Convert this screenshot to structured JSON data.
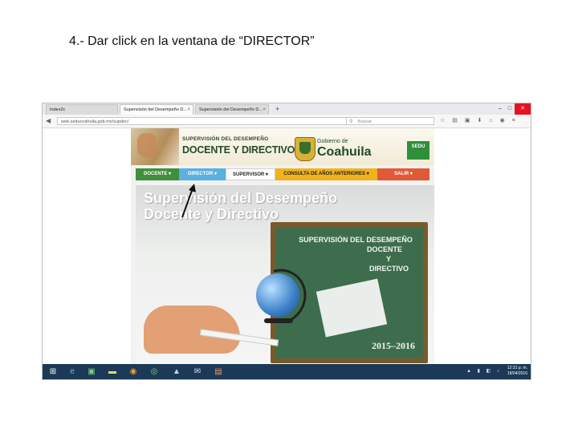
{
  "caption": "4.- Dar click en la ventana de “DIRECTOR”",
  "browser": {
    "tabs": [
      {
        "label": "Index2c",
        "active": false
      },
      {
        "label": "Supervisión del Desempeño D...",
        "active": true
      },
      {
        "label": "Supervisión del Desempeño D...",
        "active": false
      }
    ],
    "new_tab": "+",
    "url": "web.seducoahuila.gob.mx/supdoc/",
    "search_placeholder": "Buscar"
  },
  "site": {
    "header_small": "SUPERVISIÓN DEL DESEMPEÑO",
    "header_big": "DOCENTE Y DIRECTIVO",
    "gov_small": "Gobierno de",
    "gov_big": "Coahuila",
    "sedu": "SEDU",
    "menu": {
      "docente": "DOCENTE ▾",
      "director": "DIRECTOR ▾",
      "supervisor": "SUPERVISOR ▾",
      "consulta": "CONSULTA DE AÑOS ANTERIORES ▾",
      "salir": "SALIR ▾"
    },
    "banner_title_1": "Supervisión del Desempeño",
    "banner_title_2": "Docente y Directivo",
    "board_line1": "SUPERVISIÓN DEL DESEMPEÑO",
    "board_line2": "DOCENTE",
    "board_line3": "Y",
    "board_line4": "DIRECTIVO",
    "board_year": "2015–2016"
  },
  "colors": {
    "director_tab": "#5ab0e0",
    "docente_tab": "#3f8f3c",
    "consulta_tab": "#f2b21a",
    "salir_tab": "#e05a36"
  },
  "taskbar": {
    "time": "12:31 p. m.",
    "date": "18/04/2016"
  }
}
